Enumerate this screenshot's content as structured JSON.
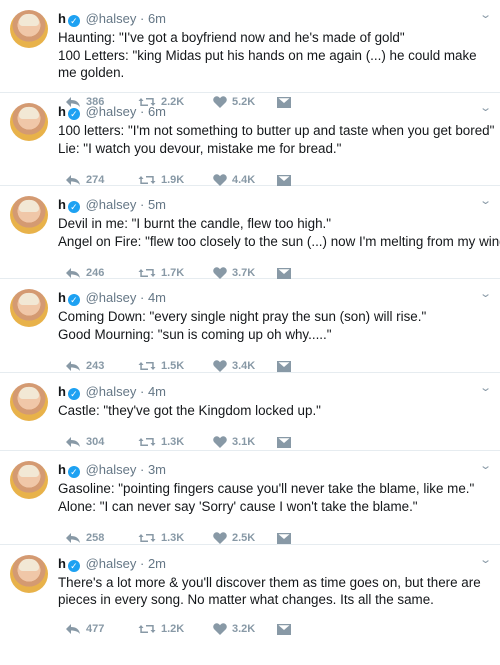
{
  "tweets": [
    {
      "name": "h",
      "handle": "@halsey",
      "time": "6m",
      "lines": [
        "Haunting: \"I've got a boyfriend now and he's made of gold\"",
        "100 Letters: \"king Midas put his hands on me again (...) he could make me golden."
      ],
      "replies": "386",
      "retweets": "2.2K",
      "likes": "5.2K"
    },
    {
      "name": "h",
      "handle": "@halsey",
      "time": "6m",
      "lines": [
        "100 letters: \"I'm not something to butter up and taste when you get bored\"",
        "Lie: \"I watch you devour, mistake me for bread.\""
      ],
      "replies": "274",
      "retweets": "1.9K",
      "likes": "4.4K"
    },
    {
      "name": "h",
      "handle": "@halsey",
      "time": "5m",
      "lines": [
        "Devil in me: \"I burnt the candle, flew too high.\"",
        "Angel on Fire: \"flew too closely to the sun (...) now I'm melting from my wings.\""
      ],
      "replies": "246",
      "retweets": "1.7K",
      "likes": "3.7K"
    },
    {
      "name": "h",
      "handle": "@halsey",
      "time": "4m",
      "lines": [
        "Coming Down: \"every single night pray the sun (son) will rise.\"",
        "Good Mourning: \"sun is coming up oh why.....\""
      ],
      "replies": "243",
      "retweets": "1.5K",
      "likes": "3.4K"
    },
    {
      "name": "h",
      "handle": "@halsey",
      "time": "4m",
      "lines": [
        "Castle: \"they've got the Kingdom locked up.\""
      ],
      "replies": "304",
      "retweets": "1.3K",
      "likes": "3.1K"
    },
    {
      "name": "h",
      "handle": "@halsey",
      "time": "3m",
      "lines": [
        "Gasoline: \"pointing fingers cause you'll never take the blame, like me.\"",
        "Alone: \"I can never say 'Sorry' cause I won't take the blame.\""
      ],
      "replies": "258",
      "retweets": "1.3K",
      "likes": "2.5K"
    },
    {
      "name": "h",
      "handle": "@halsey",
      "time": "2m",
      "lines": [
        "There's a lot more & you'll discover them as time goes on, but there are pieces in every song. No matter what changes. Its all the same."
      ],
      "replies": "477",
      "retweets": "1.2K",
      "likes": "3.2K"
    }
  ]
}
